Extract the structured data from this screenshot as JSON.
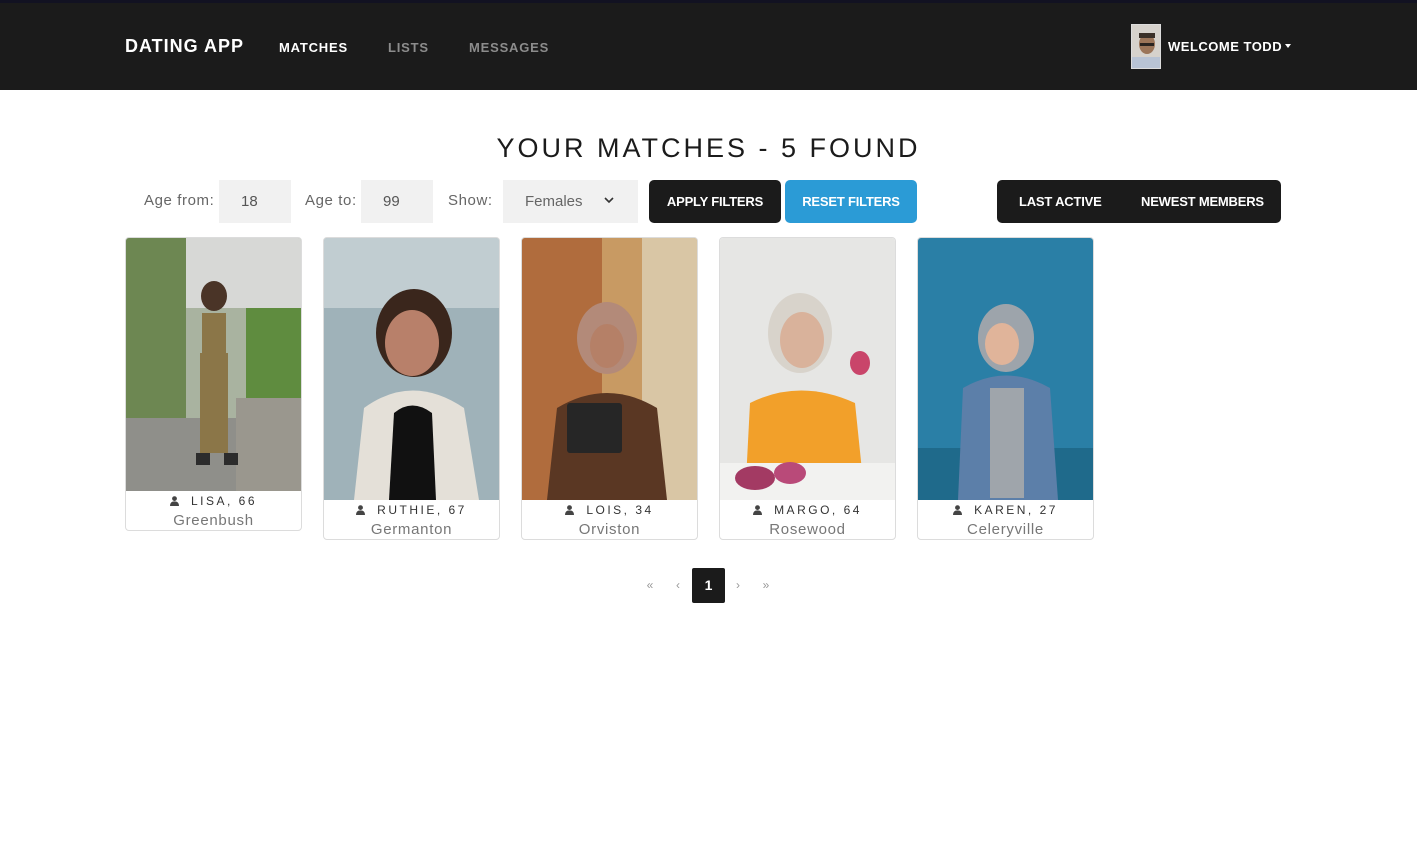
{
  "navbar": {
    "brand": "DATING APP",
    "links": [
      {
        "label": "MATCHES"
      },
      {
        "label": "LISTS"
      },
      {
        "label": "MESSAGES"
      }
    ],
    "welcome": "WELCOME TODD"
  },
  "page_title": "YOUR MATCHES - 5 FOUND",
  "filters": {
    "age_from_label": "Age from:",
    "age_from_value": "18",
    "age_to_label": "Age to:",
    "age_to_value": "99",
    "show_label": "Show:",
    "show_value": "Females",
    "apply_label": "APPLY FILTERS",
    "reset_label": "RESET FILTERS"
  },
  "sort": {
    "last_active_label": "LAST ACTIVE",
    "newest_label": "NEWEST MEMBERS"
  },
  "members": [
    {
      "name_age": "LISA, 66",
      "city": "Greenbush"
    },
    {
      "name_age": "RUTHIE, 67",
      "city": "Germanton"
    },
    {
      "name_age": "LOIS, 34",
      "city": "Orviston"
    },
    {
      "name_age": "MARGO, 64",
      "city": "Rosewood"
    },
    {
      "name_age": "KAREN, 27",
      "city": "Celeryville"
    }
  ],
  "pagination": {
    "first": "«",
    "prev": "‹",
    "current": "1",
    "next": "›",
    "last": "»"
  },
  "colors": {
    "navbar_bg": "#1b1b1b",
    "primary_dark": "#1b1b1b",
    "accent_blue": "#2b9bd6"
  }
}
